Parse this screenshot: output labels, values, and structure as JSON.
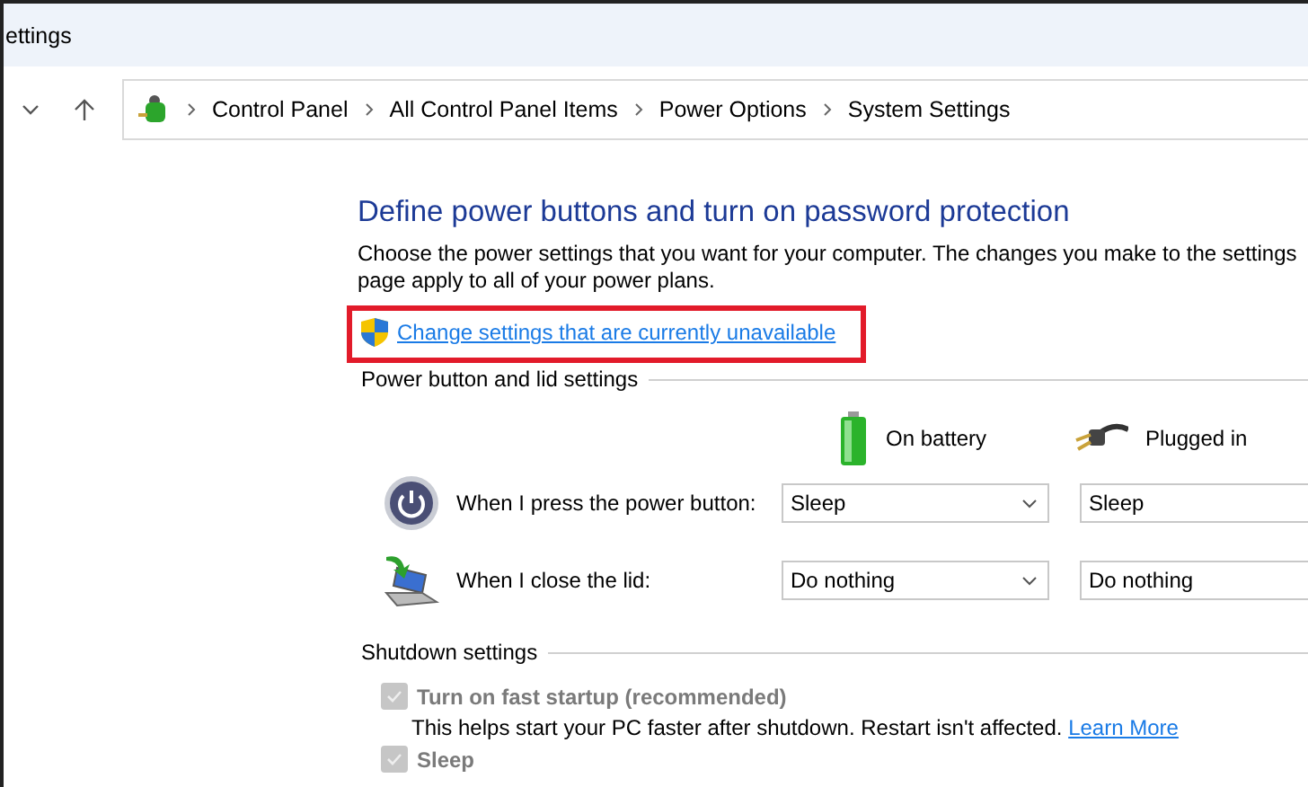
{
  "window": {
    "title": "ettings"
  },
  "breadcrumbs": [
    "Control Panel",
    "All Control Panel Items",
    "Power Options",
    "System Settings"
  ],
  "heading": "Define power buttons and turn on password protection",
  "description_lines": [
    "Choose the power settings that you want for your computer. The changes you make to the settings",
    "page apply to all of your power plans."
  ],
  "admin_link": {
    "text": "Change settings that are currently unavailable",
    "highlighted": true
  },
  "power_group": {
    "title": "Power button and lid settings",
    "columns": [
      {
        "label": "On battery",
        "kind": "battery"
      },
      {
        "label": "Plugged in",
        "kind": "plug"
      }
    ],
    "rows": [
      {
        "kind": "power",
        "label": "When I press the power button:",
        "values": [
          "Sleep",
          "Sleep"
        ]
      },
      {
        "kind": "lid",
        "label": "When I close the lid:",
        "values": [
          "Do nothing",
          "Do nothing"
        ]
      }
    ]
  },
  "shutdown_group": {
    "title": "Shutdown settings",
    "options": [
      {
        "label": "Turn on fast startup (recommended)",
        "checked": true,
        "disabled": true,
        "description": "This helps start your PC faster after shutdown. Restart isn't affected.",
        "link": "Learn More"
      },
      {
        "label": "Sleep",
        "checked": true,
        "disabled": true
      }
    ]
  }
}
